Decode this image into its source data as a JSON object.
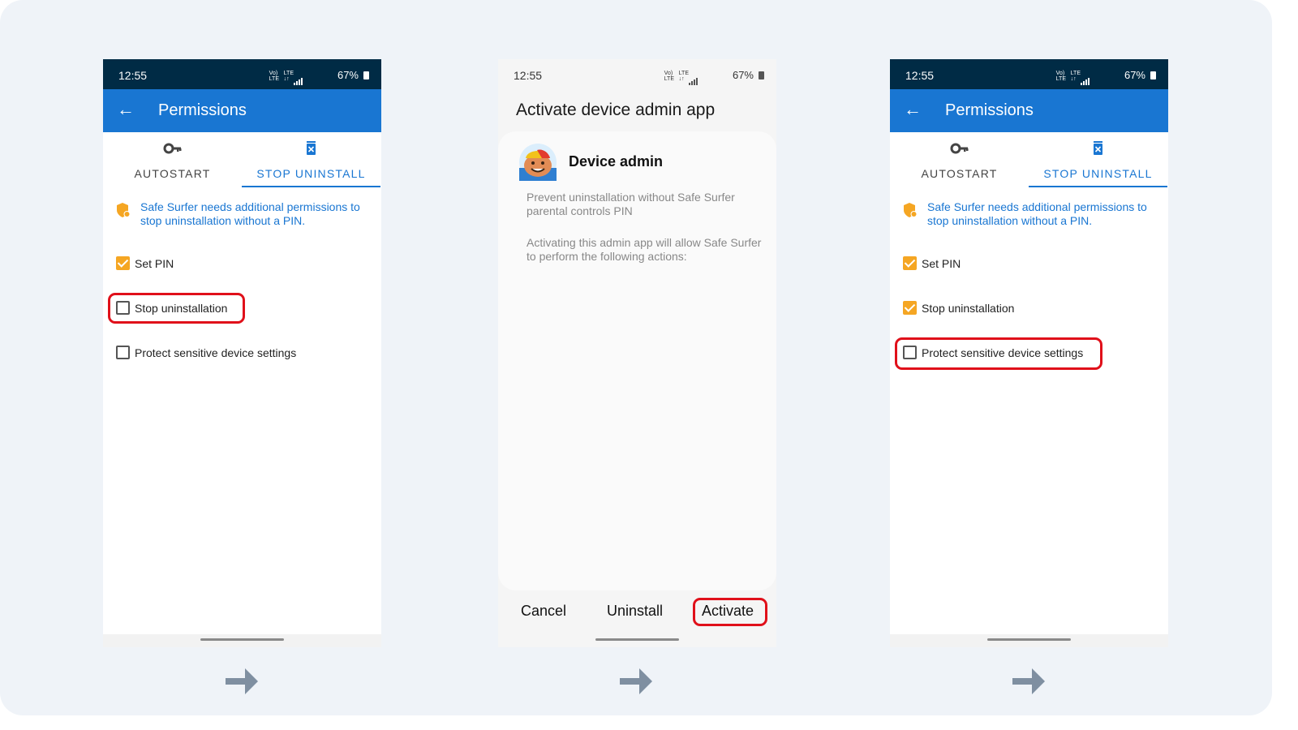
{
  "colors": {
    "background": "#eff3f8",
    "status_bar": "#002b45",
    "app_bar": "#1976d2",
    "accent_blue": "#1976d2",
    "checkbox_checked": "#f5a623",
    "highlight_red": "#e0101a",
    "arrow": "#7f8fa1"
  },
  "status_bar": {
    "time": "12:55",
    "volte": "Vo) LTE",
    "lte": "LTE",
    "battery": "67%"
  },
  "screen1": {
    "app_title": "Permissions",
    "tabs": [
      {
        "label": "AUTOSTART",
        "icon": "key-icon",
        "selected": false
      },
      {
        "label": "STOP UNINSTALL",
        "icon": "trash-icon",
        "selected": true
      }
    ],
    "notice": "Safe Surfer needs additional permissions to stop uninstallation without a PIN.",
    "options": [
      {
        "label": "Set PIN",
        "checked": true
      },
      {
        "label": "Stop uninstallation",
        "checked": false,
        "highlighted": true
      },
      {
        "label": "Protect sensitive device settings",
        "checked": false
      }
    ]
  },
  "screen2": {
    "page_title": "Activate device admin app",
    "card_title": "Device admin",
    "description": "Prevent uninstallation without Safe Surfer parental controls PIN",
    "actions_text": "Activating this admin app will allow Safe Surfer to perform the following actions:",
    "buttons": {
      "cancel": "Cancel",
      "uninstall": "Uninstall",
      "activate": "Activate"
    }
  },
  "screen3": {
    "app_title": "Permissions",
    "tabs": [
      {
        "label": "AUTOSTART",
        "icon": "key-icon",
        "selected": false
      },
      {
        "label": "STOP UNINSTALL",
        "icon": "trash-icon",
        "selected": true
      }
    ],
    "notice": "Safe Surfer needs additional permissions to stop uninstallation without a PIN.",
    "options": [
      {
        "label": "Set PIN",
        "checked": true
      },
      {
        "label": "Stop uninstallation",
        "checked": true
      },
      {
        "label": "Protect sensitive device settings",
        "checked": false,
        "highlighted": true
      }
    ]
  }
}
